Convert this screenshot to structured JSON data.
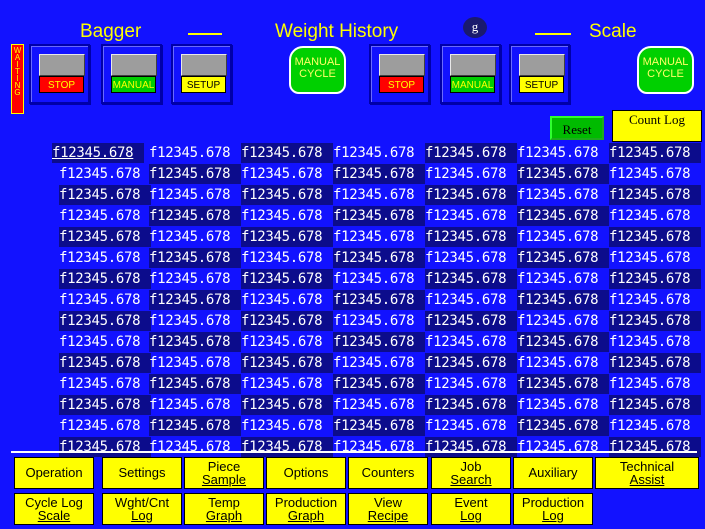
{
  "header": {
    "left_title": "Bagger",
    "center_title": "Weight History",
    "unit": "g",
    "right_title": "Scale"
  },
  "status": {
    "waiting": "WAITING"
  },
  "left_controls": {
    "stop": "STOP",
    "manual": "MANUAL",
    "setup": "SETUP",
    "cycle": "MANUAL CYCLE"
  },
  "right_controls": {
    "stop": "STOP",
    "manual": "MANUAL",
    "setup": "SETUP",
    "cycle": "MANUAL CYCLE"
  },
  "buttons": {
    "reset": "Reset",
    "count_log": "Count Log"
  },
  "weights": {
    "cell_value": "f12345.678",
    "rows": 15,
    "cols": 7
  },
  "nav_row1": [
    {
      "name": "operation-button",
      "lines": [
        "Operation"
      ]
    },
    {
      "name": "settings-button",
      "lines": [
        "Settings"
      ]
    },
    {
      "name": "piece-sample-button",
      "lines": [
        "Piece",
        "Sample"
      ]
    },
    {
      "name": "options-button",
      "lines": [
        "Options"
      ]
    },
    {
      "name": "counters-button",
      "lines": [
        "Counters"
      ]
    },
    {
      "name": "job-search-button",
      "lines": [
        "Job",
        "Search"
      ]
    },
    {
      "name": "auxiliary-button",
      "lines": [
        "Auxiliary"
      ]
    },
    {
      "name": "technical-assist-button",
      "lines": [
        "Technical",
        "Assist"
      ]
    }
  ],
  "nav_row2": [
    {
      "name": "cycle-log-scale-button",
      "lines": [
        "Cycle Log",
        "Scale"
      ]
    },
    {
      "name": "wght-cnt-log-button",
      "lines": [
        "Wght/Cnt",
        "Log"
      ]
    },
    {
      "name": "temp-graph-button",
      "lines": [
        "Temp",
        "Graph"
      ]
    },
    {
      "name": "production-graph-button",
      "lines": [
        "Production",
        "Graph"
      ]
    },
    {
      "name": "view-recipe-button",
      "lines": [
        "View",
        "Recipe"
      ]
    },
    {
      "name": "event-log-button",
      "lines": [
        "Event",
        "Log"
      ]
    },
    {
      "name": "production-log-button",
      "lines": [
        "Production",
        "Log"
      ]
    }
  ]
}
